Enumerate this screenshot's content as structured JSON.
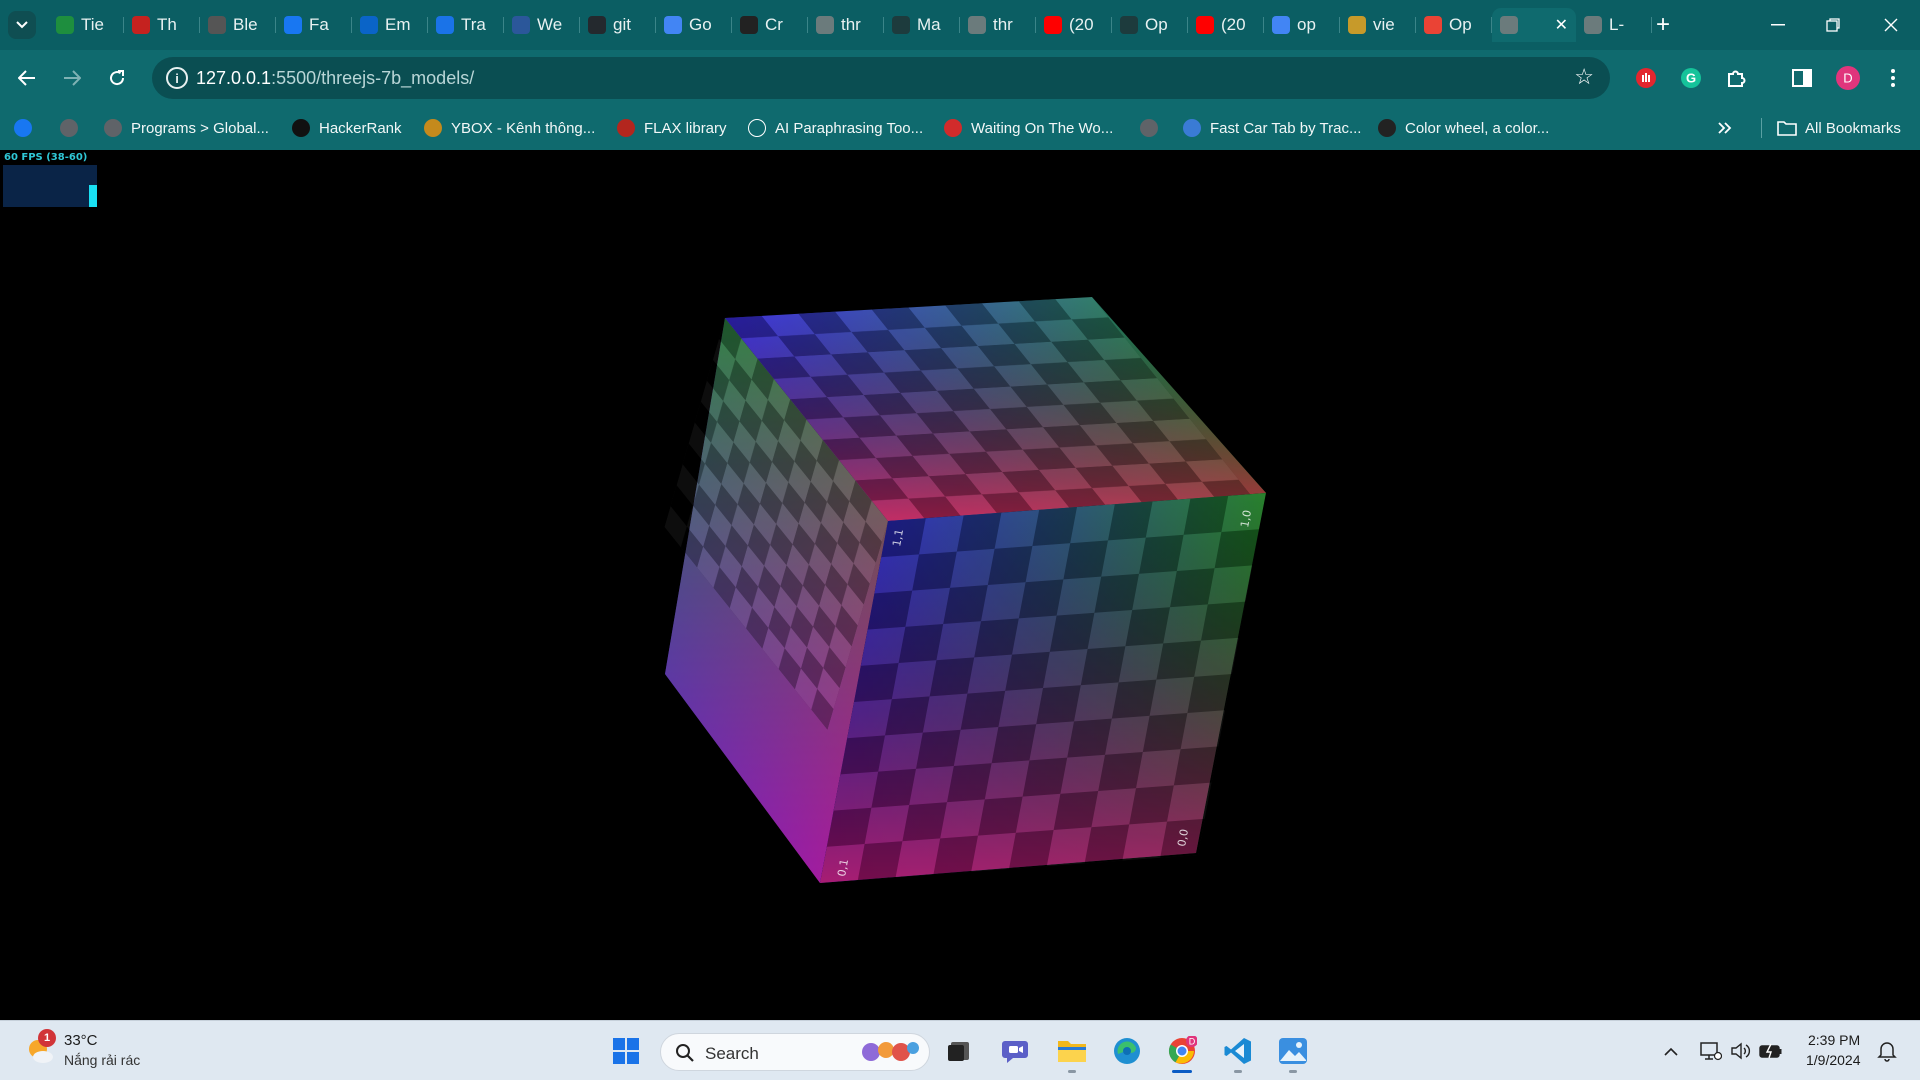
{
  "browser": {
    "tabs": [
      {
        "title": "Tie",
        "icon": "sheet-icon",
        "color": "#1e8e3e"
      },
      {
        "title": "Th",
        "icon": "gmail-icon",
        "color": "#c5221f"
      },
      {
        "title": "Ble",
        "icon": "openai-icon",
        "color": "#555555"
      },
      {
        "title": "Fa",
        "icon": "facebook-icon",
        "color": "#1877f2"
      },
      {
        "title": "Em",
        "icon": "outlook-icon",
        "color": "#0a64c8"
      },
      {
        "title": "Tra",
        "icon": "onedrive-icon",
        "color": "#1a73e8"
      },
      {
        "title": "We",
        "icon": "word-icon",
        "color": "#2b579a"
      },
      {
        "title": "git",
        "icon": "github-icon",
        "color": "#24292e"
      },
      {
        "title": "Go",
        "icon": "translate-icon",
        "color": "#4285f4"
      },
      {
        "title": "Cr",
        "icon": "triangle-icon",
        "color": "#222222"
      },
      {
        "title": "thr",
        "icon": "globe-icon",
        "color": "#6b7b7c"
      },
      {
        "title": "Ma",
        "icon": "flag-icon",
        "color": "#1d3b3d"
      },
      {
        "title": "thr",
        "icon": "globe-icon",
        "color": "#6b7b7c"
      },
      {
        "title": "(20",
        "icon": "youtube-icon",
        "color": "#ff0000"
      },
      {
        "title": "Op",
        "icon": "openai-icon",
        "color": "#1d3b3d"
      },
      {
        "title": "(20",
        "icon": "youtube-icon",
        "color": "#ff0000"
      },
      {
        "title": "op",
        "icon": "google-icon",
        "color": "#4285f4"
      },
      {
        "title": "vie",
        "icon": "feather-icon",
        "color": "#c79a2a"
      },
      {
        "title": "Op",
        "icon": "maps-pin-icon",
        "color": "#ea4335"
      },
      {
        "title": "",
        "icon": "globe-icon",
        "color": "#6b7b7c",
        "active": true
      },
      {
        "title": "L-",
        "icon": "globe-icon",
        "color": "#6b7b7c"
      }
    ],
    "url_host": "127.0.0.1",
    "url_path": ":5500/threejs-7b_models/",
    "bookmarks": [
      {
        "label": "",
        "icon": "facebook-icon",
        "color": "#1877f2"
      },
      {
        "label": "",
        "icon": "globe-icon",
        "color": "#5f6368"
      },
      {
        "label": "Programs > Global...",
        "icon": "globe-icon",
        "color": "#5f6368"
      },
      {
        "label": "HackerRank",
        "icon": "hackerrank-icon",
        "color": "#111111"
      },
      {
        "label": "YBOX - Kênh thông...",
        "icon": "ybox-icon",
        "color": "#c58a1c"
      },
      {
        "label": "FLAX library",
        "icon": "flax-icon",
        "color": "#b3261e"
      },
      {
        "label": "AI Paraphrasing Too...",
        "icon": "pen-icon",
        "color": "#ffffff"
      },
      {
        "label": "Waiting On The Wo...",
        "icon": "genius-icon",
        "color": "#d12b2b"
      },
      {
        "label": "",
        "icon": "globe-icon",
        "color": "#5f6368"
      },
      {
        "label": "Fast Car Tab by Trac...",
        "icon": "car-icon",
        "color": "#3a7bd5"
      },
      {
        "label": "Color wheel, a color...",
        "icon": "adobe-color-icon",
        "color": "#222222"
      }
    ],
    "all_bookmarks_label": "All Bookmarks"
  },
  "viewport": {
    "fps_label": "60 FPS (38-60)",
    "fps_current": 60,
    "cube_face_labels": {
      "front_top_left": "1,1",
      "front_top_right": "1,0",
      "front_bottom_left": "0,1",
      "front_bottom_right": "0,0"
    },
    "colors": {
      "blue": "#2424e0",
      "red": "#e22020",
      "green": "#1e9a2c",
      "magenta": "#c023d8"
    }
  },
  "taskbar": {
    "weather_temp": "33°C",
    "weather_desc": "Nắng rải rác",
    "weather_badge": "1",
    "search_placeholder": "Search",
    "time": "2:39 PM",
    "date": "1/9/2024",
    "apps": [
      {
        "name": "start-button",
        "running": false
      },
      {
        "name": "task-view-button",
        "running": false
      },
      {
        "name": "teams-meet-icon",
        "running": false
      },
      {
        "name": "file-explorer-icon",
        "running": true
      },
      {
        "name": "edge-icon",
        "running": false
      },
      {
        "name": "chrome-icon",
        "running": true,
        "active": true
      },
      {
        "name": "vscode-icon",
        "running": true
      },
      {
        "name": "photos-icon",
        "running": true
      }
    ]
  }
}
